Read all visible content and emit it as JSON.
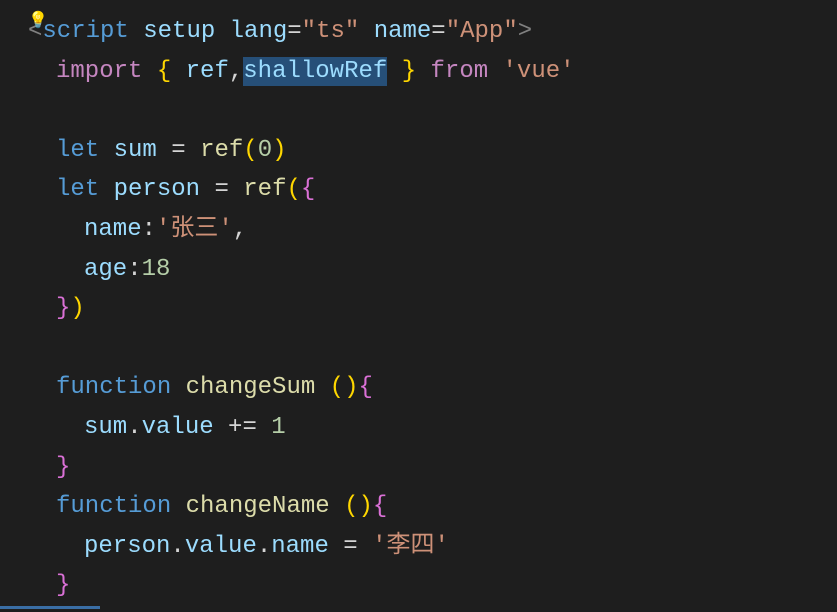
{
  "gutter": {
    "lightbulb": "💡"
  },
  "code": {
    "line1": {
      "tagOpen": "<",
      "tagName": "script",
      "attr1": "setup",
      "attr2": "lang",
      "eq": "=",
      "val2": "\"ts\"",
      "attr3": "name",
      "val3": "\"App\"",
      "tagClose": ">"
    },
    "line2": {
      "import": "import",
      "braceOpen": "{",
      "ref": "ref",
      "comma": ",",
      "shallowRef": "shallowRef",
      "braceClose": "}",
      "from": "from",
      "vue": "'vue'"
    },
    "line4": {
      "let": "let",
      "sum": "sum",
      "eq": "=",
      "ref": "ref",
      "parenOpen": "(",
      "zero": "0",
      "parenClose": ")"
    },
    "line5": {
      "let": "let",
      "person": "person",
      "eq": "=",
      "ref": "ref",
      "parenOpen": "(",
      "braceOpen": "{"
    },
    "line6": {
      "name": "name",
      "colon": ":",
      "value": "'张三'",
      "comma": ","
    },
    "line7": {
      "age": "age",
      "colon": ":",
      "value": "18"
    },
    "line8": {
      "braceClose": "}",
      "parenClose": ")"
    },
    "line10": {
      "function": "function",
      "name": "changeSum",
      "parenOpen": "(",
      "parenClose": ")",
      "braceOpen": "{"
    },
    "line11": {
      "sum": "sum",
      "dot": ".",
      "value": "value",
      "op": "+=",
      "one": "1"
    },
    "line12": {
      "braceClose": "}"
    },
    "line13": {
      "function": "function",
      "name": "changeName",
      "parenOpen": "(",
      "parenClose": ")",
      "braceOpen": "{"
    },
    "line14": {
      "person": "person",
      "dot1": ".",
      "value": "value",
      "dot2": ".",
      "nameProp": "name",
      "eq": "=",
      "str": "'李四'"
    },
    "line15": {
      "braceClose": "}"
    }
  }
}
